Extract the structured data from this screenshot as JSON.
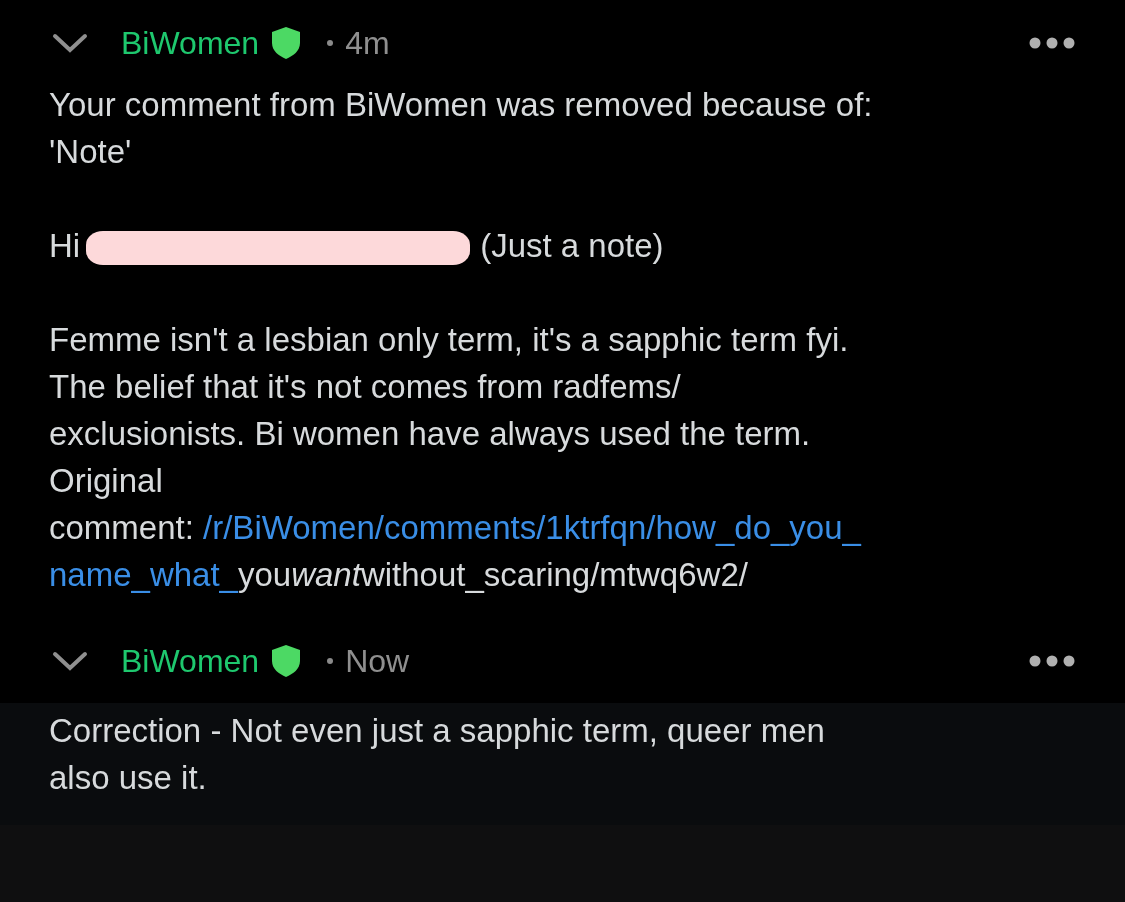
{
  "comments": [
    {
      "author": "BiWomen",
      "moderator": true,
      "time": "4m",
      "collapsed": false,
      "highlighted": false,
      "paragraphs": [
        {
          "kind": "lines",
          "lines": [
            "Your comment from BiWomen was removed because of:",
            "'Note'"
          ]
        },
        {
          "kind": "greeting",
          "before": "Hi",
          "after": "(Just a note)"
        },
        {
          "kind": "lines",
          "lines": [
            "Femme isn't a lesbian only term, it's a sapphic term fyi.",
            "The belief that it's not comes from radfems/",
            "exclusionists. Bi women have always used the term.",
            "Original"
          ]
        },
        {
          "kind": "link",
          "label": "comment:",
          "link": [
            "/r/BiWomen/comments/1ktrfqn/how_do_you_",
            "name_what_"
          ],
          "tail": [
            {
              "text": "you",
              "italic": false
            },
            {
              "text": "want",
              "italic": true
            },
            {
              "text": "without_scaring/mtwq6w2/",
              "italic": false
            }
          ]
        }
      ]
    },
    {
      "author": "BiWomen",
      "moderator": true,
      "time": "Now",
      "collapsed": false,
      "highlighted": true,
      "paragraphs": [
        {
          "kind": "lines",
          "lines": [
            "Correction - Not even just a sapphic term, queer men",
            "also use it."
          ]
        }
      ]
    }
  ]
}
